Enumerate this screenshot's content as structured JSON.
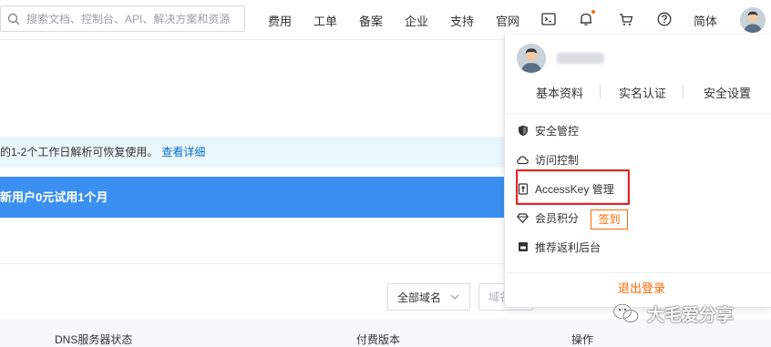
{
  "search": {
    "placeholder": "搜索文档、控制台、API、解决方案和资源"
  },
  "nav": {
    "items": [
      "费用",
      "工单",
      "备案",
      "企业",
      "支持",
      "官网"
    ],
    "lang": "简体",
    "icons": [
      "terminal-icon",
      "bell-icon",
      "cart-icon",
      "help-icon"
    ]
  },
  "notice": {
    "text": "的1-2个工作日解析可恢复使用。",
    "link": "查看详细"
  },
  "promo": {
    "text": "新用户0元试用1个月"
  },
  "filters": {
    "select_label": "全部域名",
    "search_placeholder": "域名"
  },
  "table": {
    "headers": [
      "DNS服务器状态",
      "付费版本",
      "操作"
    ]
  },
  "panel": {
    "tabs": [
      "基本资料",
      "实名认证",
      "安全设置"
    ],
    "menu": [
      {
        "icon": "shield-icon",
        "label": "安全管控"
      },
      {
        "icon": "cloud-icon",
        "label": "访问控制"
      },
      {
        "icon": "key-icon",
        "label": "AccessKey 管理"
      },
      {
        "icon": "diamond-icon",
        "label": "会员积分"
      },
      {
        "icon": "clipboard-icon",
        "label": "推荐返利后台"
      }
    ],
    "sign_button": "签到",
    "logout": "退出登录"
  },
  "watermark": {
    "text": "大毛爱分享"
  },
  "colors": {
    "accent": "#ff6a00",
    "link": "#0070cc",
    "promo_bg": "#3b8ff0",
    "notice_bg": "#eaf5fc",
    "highlight": "#d9272b"
  }
}
